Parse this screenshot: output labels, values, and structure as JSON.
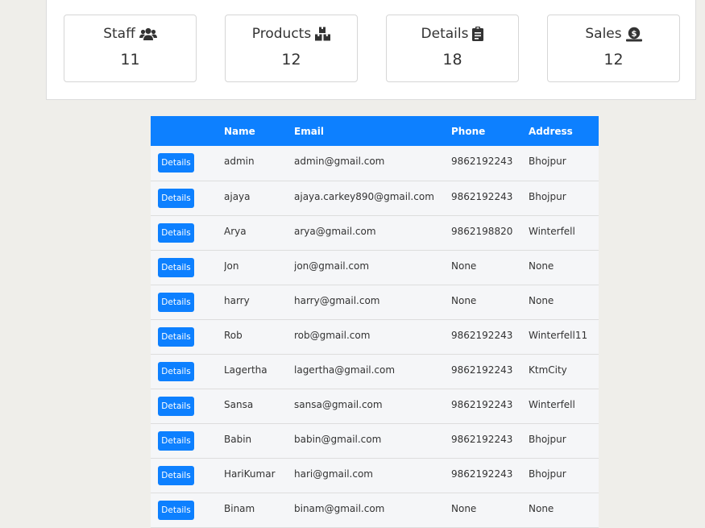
{
  "stats": [
    {
      "label": "Staff",
      "value": "11",
      "icon": "users-icon"
    },
    {
      "label": "Products",
      "value": "12",
      "icon": "boxes-icon"
    },
    {
      "label": "Details",
      "value": "18",
      "icon": "clipboard-icon"
    },
    {
      "label": "Sales",
      "value": "12",
      "icon": "money-bag-icon"
    }
  ],
  "table": {
    "headers": {
      "action": "",
      "name": "Name",
      "email": "Email",
      "phone": "Phone",
      "address": "Address"
    },
    "button_label": "Details",
    "rows": [
      {
        "name": "admin",
        "email": "admin@gmail.com",
        "phone": "9862192243",
        "address": "Bhojpur"
      },
      {
        "name": "ajaya",
        "email": "ajaya.carkey890@gmail.com",
        "phone": "9862192243",
        "address": "Bhojpur"
      },
      {
        "name": "Arya",
        "email": "arya@gmail.com",
        "phone": "9862198820",
        "address": "Winterfell"
      },
      {
        "name": "Jon",
        "email": "jon@gmail.com",
        "phone": "None",
        "address": "None"
      },
      {
        "name": "harry",
        "email": "harry@gmail.com",
        "phone": "None",
        "address": "None"
      },
      {
        "name": "Rob",
        "email": "rob@gmail.com",
        "phone": "9862192243",
        "address": "Winterfell11"
      },
      {
        "name": "Lagertha",
        "email": "lagertha@gmail.com",
        "phone": "9862192243",
        "address": "KtmCity"
      },
      {
        "name": "Sansa",
        "email": "sansa@gmail.com",
        "phone": "9862192243",
        "address": "Winterfell"
      },
      {
        "name": "Babin",
        "email": "babin@gmail.com",
        "phone": "9862192243",
        "address": "Bhojpur"
      },
      {
        "name": "HariKumar",
        "email": "hari@gmail.com",
        "phone": "9862192243",
        "address": "Bhojpur"
      },
      {
        "name": "Binam",
        "email": "binam@gmail.com",
        "phone": "None",
        "address": "None"
      }
    ]
  },
  "colors": {
    "primary": "#0d80ff",
    "row_bg": "#f5f6f8",
    "page_bg": "#efeeea"
  }
}
